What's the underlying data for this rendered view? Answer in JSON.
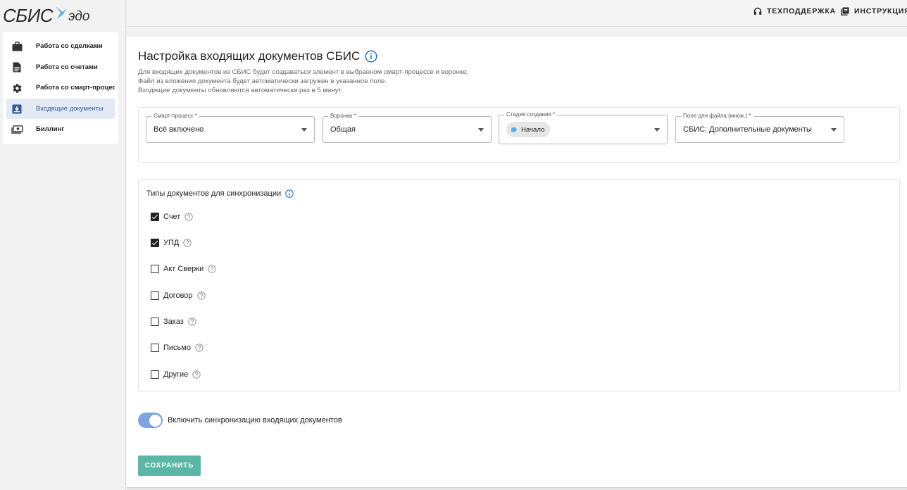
{
  "brand": {
    "logo_main": "СБИС",
    "logo_sub": "эдо",
    "accent_color": "#5aaee6"
  },
  "sidebar": {
    "items": [
      {
        "label": "Работа со сделками",
        "icon": "briefcase-icon",
        "active": false
      },
      {
        "label": "Работа со счетами",
        "icon": "document-icon",
        "active": false
      },
      {
        "label": "Работа со смарт-процессами",
        "icon": "gear-icon",
        "active": false
      },
      {
        "label": "Входящие документы",
        "icon": "inbox-download-icon",
        "active": true
      },
      {
        "label": "Биллинг",
        "icon": "money-icon",
        "active": false
      }
    ]
  },
  "topbar": {
    "support_label": "ТЕХПОДДЕРЖКА",
    "instructions_label": "ИНСТРУКЦИЯ"
  },
  "main": {
    "title": "Настройка входящих документов СБИС",
    "description": [
      "Для входящих документов из СБИС будет создаваться элемент в выбранном смарт-процессе и воронке.",
      "Файл из вложения документа будет автоматически загружен в указанное поле.",
      "Входящие документы обновляются автоматически раз в 5 минут."
    ],
    "fields": {
      "smart_process": {
        "label": "Смарт-процесс *",
        "value": "Всё включено"
      },
      "funnel": {
        "label": "Воронка *",
        "value": "Общая"
      },
      "stage": {
        "label": "Стадия создания *",
        "value": "Начало"
      },
      "file_field": {
        "label": "Поле для файла (множ.) *",
        "value": "СБИС: Дополнительные документы"
      }
    },
    "doc_types": {
      "title": "Типы документов для синхронизации",
      "items": [
        {
          "label": "Счет",
          "checked": true
        },
        {
          "label": "УПД",
          "checked": true
        },
        {
          "label": "Акт Сверки",
          "checked": false
        },
        {
          "label": "Договор",
          "checked": false
        },
        {
          "label": "Заказ",
          "checked": false
        },
        {
          "label": "Письмо",
          "checked": false
        },
        {
          "label": "Другие",
          "checked": false
        }
      ]
    },
    "sync_toggle": {
      "label": "Включить синхронизацию входящих документов",
      "enabled": true
    },
    "save_label": "СОХРАНИТЬ",
    "save_color": "#5bb6a7",
    "toggle_color": "#7fa4db"
  }
}
